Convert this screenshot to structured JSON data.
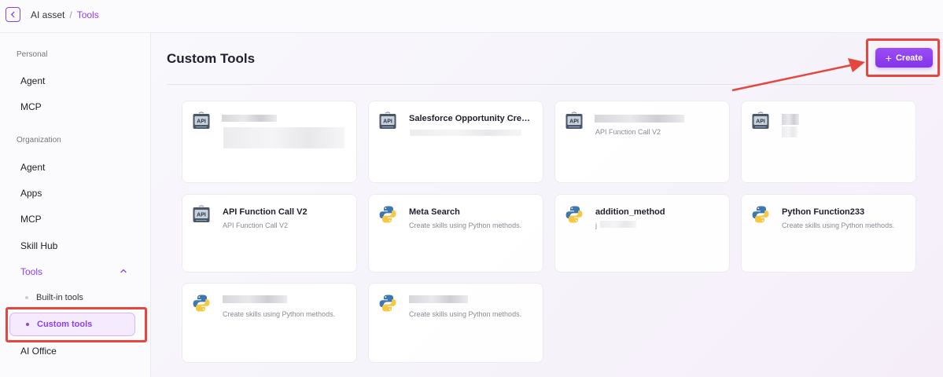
{
  "breadcrumb": {
    "root": "AI asset",
    "separator": "/",
    "current": "Tools"
  },
  "sidebar": {
    "personal_label": "Personal",
    "personal_items": [
      "Agent",
      "MCP"
    ],
    "organization_label": "Organization",
    "org_items": [
      "Agent",
      "Apps",
      "MCP",
      "Skill Hub"
    ],
    "tools_label": "Tools",
    "tools_sub": [
      "Built-in tools",
      "Custom tools"
    ],
    "ai_office": "AI Office"
  },
  "main": {
    "title": "Custom Tools",
    "create_label": "Create",
    "cards": [
      {
        "icon": "api-icon",
        "name": "",
        "desc": ""
      },
      {
        "icon": "api-icon",
        "name": "Salesforce Opportunity Creati...",
        "desc": ""
      },
      {
        "icon": "api-icon",
        "name": "",
        "desc": "API Function Call V2"
      },
      {
        "icon": "api-icon",
        "name": "",
        "desc": ""
      },
      {
        "icon": "api-icon",
        "name": "API Function Call V2",
        "desc": "API Function Call V2"
      },
      {
        "icon": "python-icon",
        "name": "Meta Search",
        "desc": "Create skills using Python methods."
      },
      {
        "icon": "python-icon",
        "name": "addition_method",
        "desc": "j"
      },
      {
        "icon": "python-icon",
        "name": "Python Function233",
        "desc": "Create skills using Python methods."
      },
      {
        "icon": "python-icon",
        "name": "",
        "desc": "Create skills using Python methods."
      },
      {
        "icon": "python-icon",
        "name": "",
        "desc": "Create skills using Python methods."
      }
    ]
  },
  "colors": {
    "accent": "#8a3ff0",
    "highlight": "#e5473f"
  }
}
